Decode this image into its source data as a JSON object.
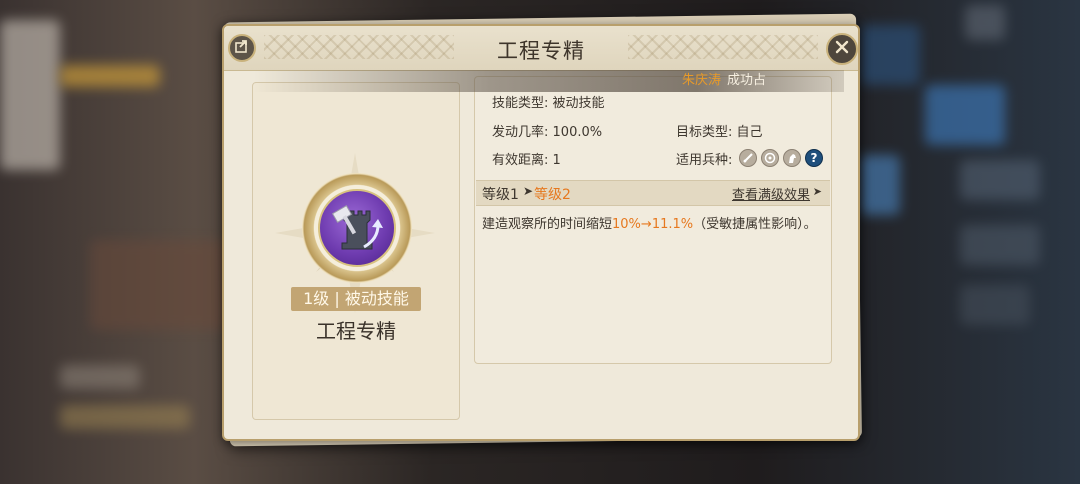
{
  "dialog": {
    "title": "工程专精",
    "share_icon": "share-icon",
    "close_icon": "close-icon"
  },
  "notice": {
    "player_name": "朱庆涛",
    "message": "成功占"
  },
  "skill": {
    "level_badge": "1级 | 被动技能",
    "name": "工程专精",
    "icon": "hammer-rook-icon"
  },
  "details": {
    "skill_type": {
      "label": "技能类型:",
      "value": "被动技能"
    },
    "trigger_rate": {
      "label": "发动几率:",
      "value": "100.0%"
    },
    "target_type": {
      "label": "目标类型:",
      "value": "自己"
    },
    "range": {
      "label": "有效距离:",
      "value": "1"
    },
    "troop_types": {
      "label": "适用兵种:",
      "icons": [
        "sword-icon",
        "target-icon",
        "horse-icon",
        "help-icon"
      ],
      "help_glyph": "?"
    }
  },
  "level_row": {
    "current": "等级1",
    "next": "等级2",
    "max_link": "查看满级效果"
  },
  "effect": {
    "prefix": "建造观察所的时间缩短",
    "from": "10%",
    "arrow_to": "→11.1%",
    "suffix": "（受敏捷属性影响）。"
  },
  "colors": {
    "accent_orange": "#e6781e",
    "notice_name": "#e79a2a",
    "skill_purple": "#6f3cb0",
    "frame_gold": "#b89f6c"
  }
}
